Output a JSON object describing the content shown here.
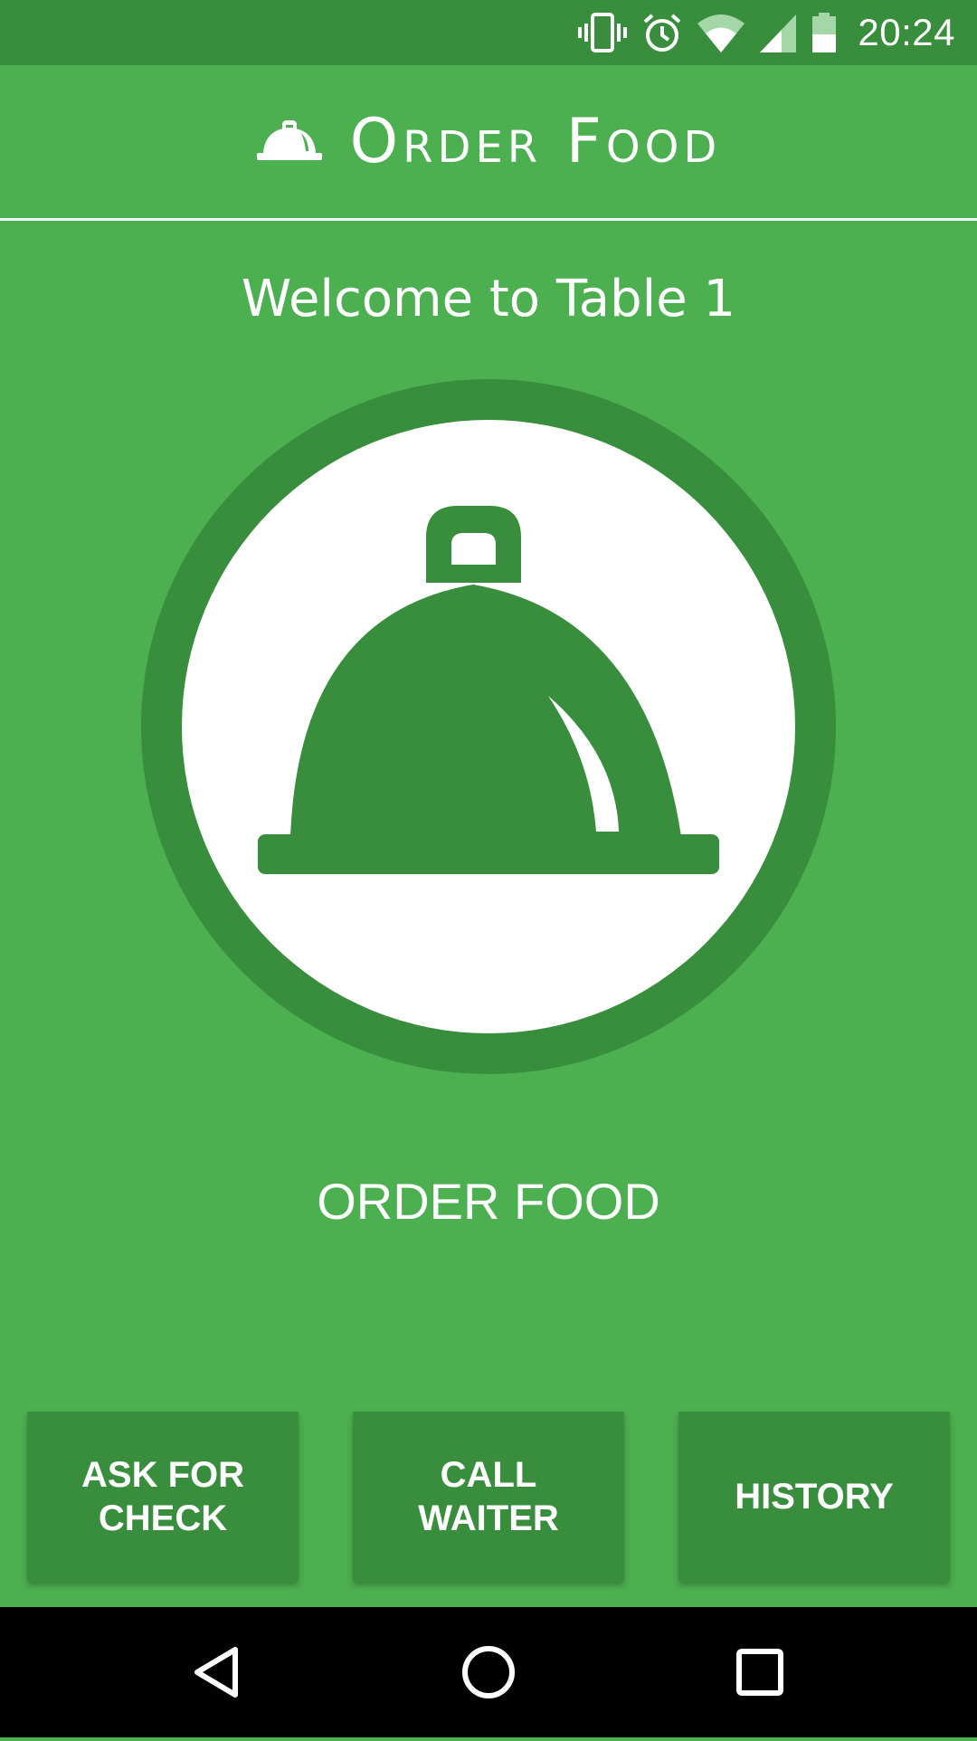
{
  "status_bar": {
    "time": "20:24",
    "icons": [
      "vibrate-icon",
      "alarm-icon",
      "wifi-icon",
      "signal-icon",
      "battery-icon"
    ]
  },
  "header": {
    "title": "Order Food",
    "icon": "cloche-icon"
  },
  "welcome_text": "Welcome to Table 1",
  "order_button": {
    "icon": "cloche-icon",
    "label": "ORDER FOOD"
  },
  "actions": [
    {
      "label": "ASK FOR CHECK"
    },
    {
      "label": "CALL WAITER"
    },
    {
      "label": "HISTORY"
    }
  ],
  "nav_bar": {
    "buttons": [
      "back-icon",
      "home-icon",
      "recents-icon"
    ]
  },
  "colors": {
    "primary": "#4caf50",
    "primary_dark": "#388e3c",
    "text": "#ffffff"
  }
}
